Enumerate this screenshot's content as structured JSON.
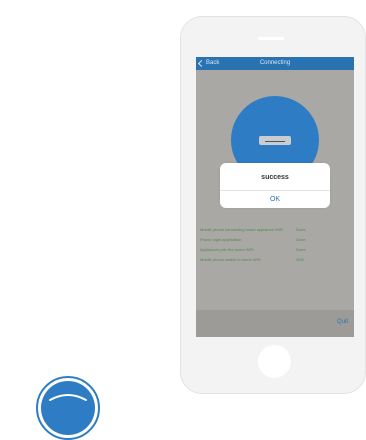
{
  "colors": {
    "accent": "#2a73b3",
    "device_circle": "#2e7cc3",
    "screen_overlay": "#a9a8a5",
    "status_text": "#4f8a47"
  },
  "icons": {
    "back": "chevron-left-icon",
    "device": "air-conditioner-icon",
    "logo": "logo-icon"
  },
  "navbar": {
    "back_label": "Back",
    "title": "Connecting"
  },
  "status": {
    "items": [
      {
        "label": "Mobile phone connecting home appliance WiFi",
        "value": "Done"
      },
      {
        "label": "Phone login application",
        "value": "Done"
      },
      {
        "label": "Appliances join the home WiFi",
        "value": "Done"
      },
      {
        "label": "Mobile phone switch to home WiFi",
        "value": "30%"
      }
    ]
  },
  "dialog": {
    "message": "success",
    "ok_label": "OK"
  },
  "footer": {
    "quit_label": "Quit"
  }
}
